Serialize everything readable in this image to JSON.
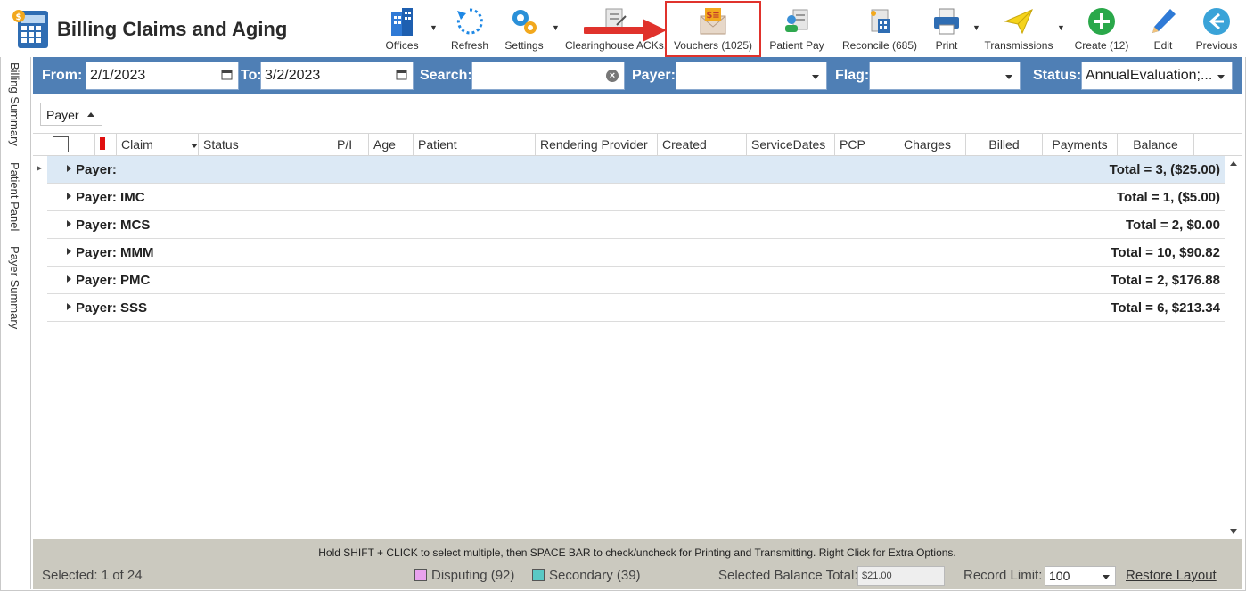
{
  "app": {
    "title": "Billing Claims and Aging"
  },
  "toolbar": {
    "offices": "Offices",
    "refresh": "Refresh",
    "settings": "Settings",
    "clearinghouse": "Clearinghouse ACKs.",
    "vouchers": "Vouchers (1025)",
    "patient_pay": "Patient Pay",
    "reconcile": "Reconcile (685)",
    "print": "Print",
    "transmissions": "Transmissions",
    "create": "Create (12)",
    "edit": "Edit",
    "previous": "Previous"
  },
  "sidebar": {
    "tabs": [
      "Billing Summary",
      "Patient Panel",
      "Payer Summary"
    ]
  },
  "filters": {
    "from_label": "From:",
    "from_value": "2/1/2023",
    "to_label": "To:",
    "to_value": "3/2/2023",
    "search_label": "Search:",
    "search_value": "",
    "payer_label": "Payer:",
    "payer_value": "",
    "flag_label": "Flag:",
    "flag_value": "",
    "status_label": "Status:",
    "status_value": "AnnualEvaluation;..."
  },
  "grouping": {
    "group_by": "Payer"
  },
  "grid": {
    "columns": [
      "Claim",
      "Status",
      "P/I",
      "Age",
      "Patient",
      "Rendering Provider",
      "Created",
      "ServiceDates",
      "PCP",
      "Charges",
      "Billed",
      "Payments",
      "Balance"
    ],
    "groups": [
      {
        "name": "Payer:",
        "total": "Total = 3,  ($25.00)"
      },
      {
        "name": "Payer: IMC",
        "total": "Total = 1,  ($5.00)"
      },
      {
        "name": "Payer: MCS",
        "total": "Total = 2,  $0.00"
      },
      {
        "name": "Payer: MMM",
        "total": "Total = 10,  $90.82"
      },
      {
        "name": "Payer: PMC",
        "total": "Total = 2,  $176.88"
      },
      {
        "name": "Payer: SSS",
        "total": "Total = 6,  $213.34"
      }
    ]
  },
  "footer": {
    "hint": "Hold SHIFT + CLICK to select multiple, then SPACE BAR to check/uncheck for Printing and Transmitting. Right Click for Extra Options.",
    "selected": "Selected: 1 of 24",
    "disputing": "Disputing (92)",
    "secondary": "Secondary (39)",
    "balance_label": "Selected Balance Total:",
    "balance_value": "$21.00",
    "record_limit_label": "Record Limit:",
    "record_limit_value": "100",
    "restore_layout": "Restore Layout"
  },
  "colors": {
    "filter_bar": "#4f7fb5",
    "footer": "#cbc9bf",
    "selected_row": "#dce9f5",
    "highlight_box": "#e0322c",
    "disputing": "#e9a2ee",
    "secondary": "#59c8c4"
  }
}
